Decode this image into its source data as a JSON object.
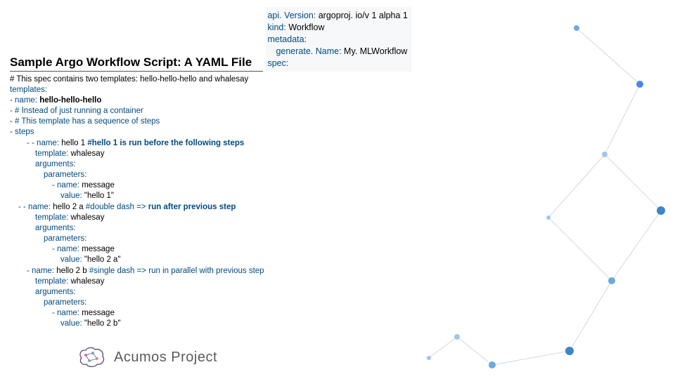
{
  "title": "Sample Argo Workflow Script: A YAML File",
  "block1": {
    "l1a": "api. Version: ",
    "l1b": "argoproj. io/v 1 alpha 1",
    "l2a": "kind: ",
    "l2b": "Workflow",
    "l3": "metadata:",
    "l4a": "generate. Name: ",
    "l4b": "My. MLWorkflow",
    "l5": "spec:"
  },
  "block2": {
    "c1": "# This spec contains two templates: hello-hello-hello and whalesay",
    "c2": "templates:",
    "c3a": "-   name: ",
    "c3b": "hello-hello-hello",
    "c4": "-   # Instead of just running a container",
    "c5": "-   # This template has a sequence of steps",
    "c6": "-   steps",
    "c7a": "- - name: ",
    "c7b": "hello 1  ",
    "c7c": "#hello 1 is run before the following steps",
    "c8a": "template: ",
    "c8b": "whalesay",
    "c9": "arguments:",
    "c10": "parameters:",
    "c11a": "- name: ",
    "c11b": "message",
    "c12a": "value: ",
    "c12b": "\"hello 1\"",
    "d1a": "- - name: ",
    "d1b": "hello 2 a ",
    "d1c": "#double dash => ",
    "d1d": "run after previous step",
    "d2a": "template: ",
    "d2b": "whalesay",
    "d3": "arguments:",
    "d4": "parameters:",
    "d5a": "- name: ",
    "d5b": "message",
    "d6a": "value: ",
    "d6b": "\"hello 2 a\"",
    "e1a": "- name: ",
    "e1b": "hello 2 b ",
    "e1c": "#single dash => run in parallel with previous step",
    "e2a": "template: ",
    "e2b": "whalesay",
    "e3": "arguments:",
    "e4": "parameters:",
    "e5a": "- name: ",
    "e5b": "message",
    "e6a": "value: ",
    "e6b": "\"hello 2 b\""
  },
  "footer": "Acumos Project"
}
